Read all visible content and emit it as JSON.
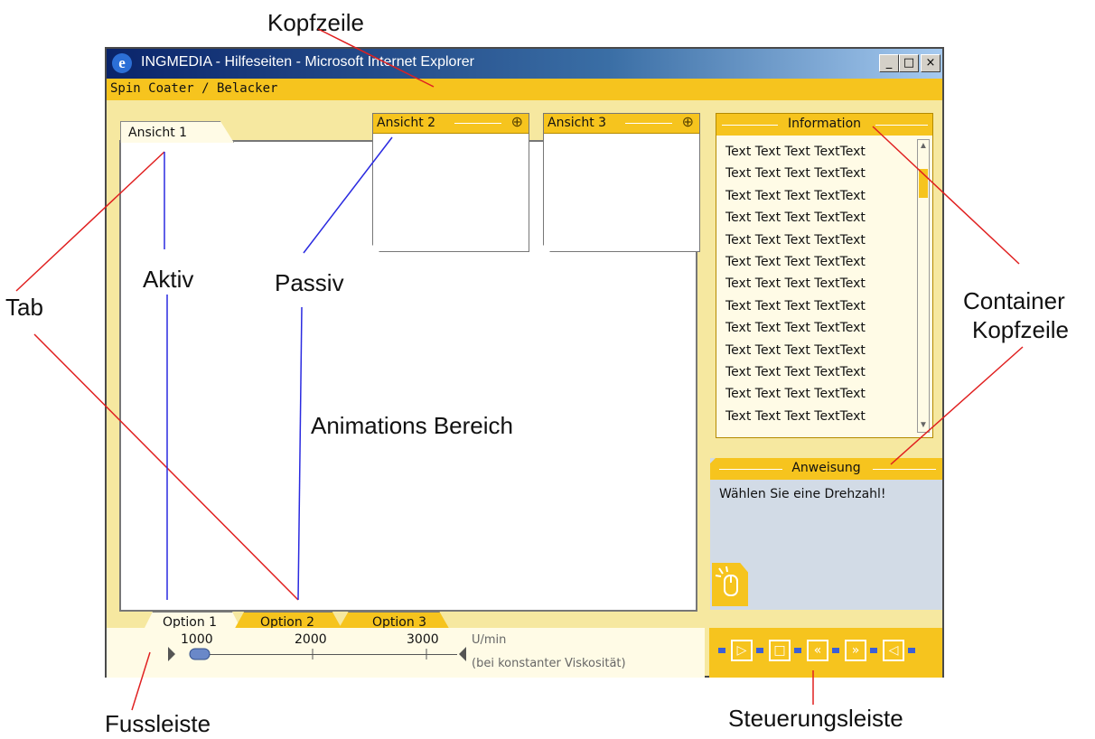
{
  "annotations": {
    "kopfzeile": "Kopfzeile",
    "tab": "Tab",
    "aktiv": "Aktiv",
    "passiv": "Passiv",
    "animations_bereich": "Animations Bereich",
    "container_kopfzeile_1": "Container",
    "container_kopfzeile_2": "Kopfzeile",
    "fussleiste": "Fussleiste",
    "steuerungsleiste": "Steuerungsleiste"
  },
  "window": {
    "title": "INGMEDIA - Hilfeseiten - Microsoft Internet Explorer",
    "buttons": {
      "minimize": "_",
      "maximize": "□",
      "close": "×"
    }
  },
  "header": {
    "title": "Spin Coater / Belacker"
  },
  "main_tab": {
    "label": "Ansicht 1"
  },
  "views": [
    {
      "label": "Ansicht 2",
      "icon": "zoom-in-icon"
    },
    {
      "label": "Ansicht 3",
      "icon": "zoom-in-icon"
    }
  ],
  "info_panel": {
    "title": "Information",
    "lines": [
      "Text Text Text TextText",
      "Text Text Text TextText",
      "Text Text Text TextText",
      "Text Text Text TextText",
      "Text Text Text TextText",
      "Text Text Text TextText",
      "Text Text Text TextText",
      "Text Text Text TextText",
      "Text Text Text TextText",
      "Text Text Text TextText",
      "Text Text Text TextText",
      "Text Text Text TextText",
      "Text Text Text TextText"
    ]
  },
  "instruction_panel": {
    "title": "Anweisung",
    "text": "Wählen Sie eine Drehzahl!",
    "icon": "mouse-icon"
  },
  "options": [
    "Option 1",
    "Option 2",
    "Option 3"
  ],
  "slider": {
    "ticks": [
      "1000",
      "2000",
      "3000"
    ],
    "unit": "U/min",
    "note": "(bei konstanter Viskosität)",
    "value": 1000
  },
  "controls": {
    "icons": [
      "play-icon",
      "stop-icon",
      "rewind-icon",
      "fast-forward-icon",
      "speaker-icon"
    ]
  },
  "colors": {
    "accent": "#f6c41e",
    "panel_bg": "#fffbe6",
    "instruction_bg": "#d2dbe6",
    "annotation_red": "#e02020",
    "annotation_blue": "#2a2ae0"
  }
}
